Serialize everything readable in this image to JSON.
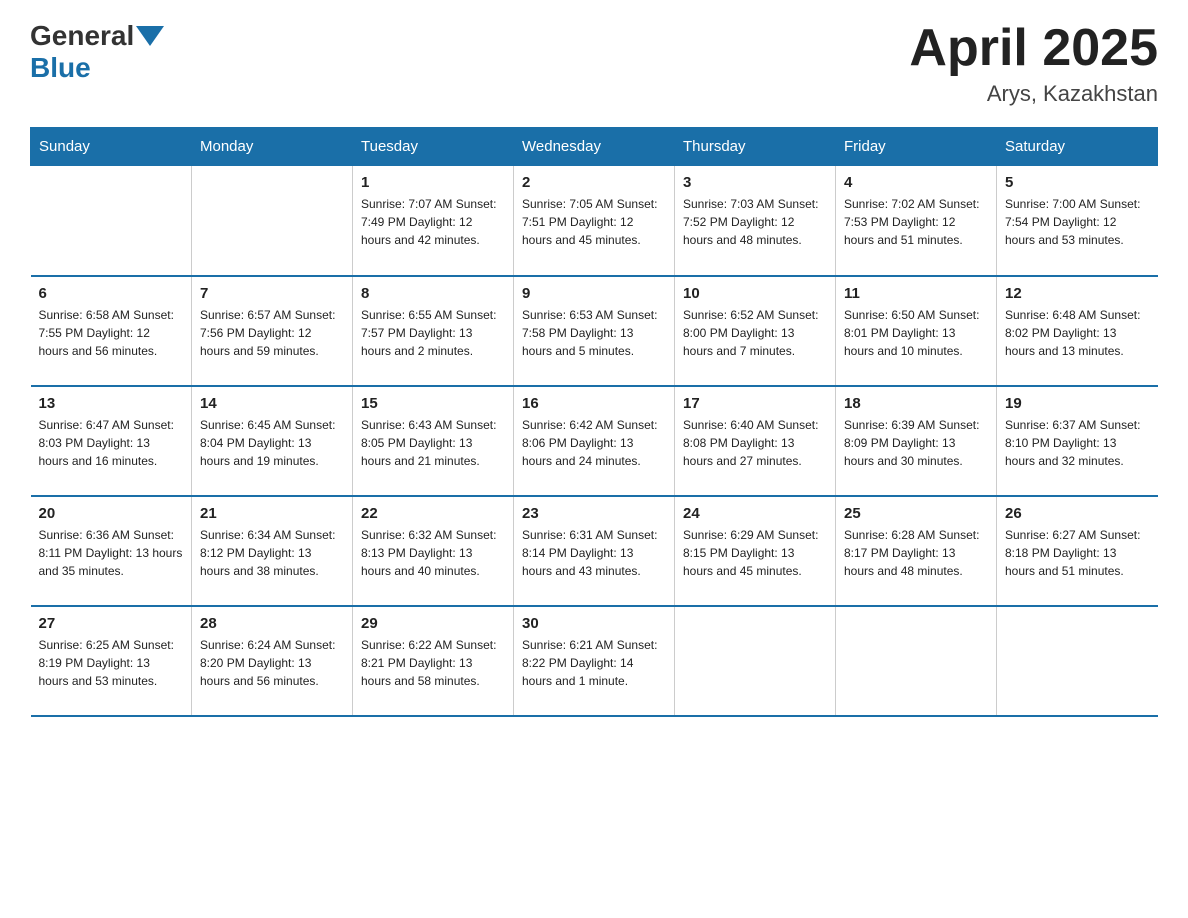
{
  "header": {
    "logo_general": "General",
    "logo_blue": "Blue",
    "month": "April 2025",
    "location": "Arys, Kazakhstan"
  },
  "weekdays": [
    "Sunday",
    "Monday",
    "Tuesday",
    "Wednesday",
    "Thursday",
    "Friday",
    "Saturday"
  ],
  "weeks": [
    [
      {
        "day": "",
        "info": ""
      },
      {
        "day": "",
        "info": ""
      },
      {
        "day": "1",
        "info": "Sunrise: 7:07 AM\nSunset: 7:49 PM\nDaylight: 12 hours\nand 42 minutes."
      },
      {
        "day": "2",
        "info": "Sunrise: 7:05 AM\nSunset: 7:51 PM\nDaylight: 12 hours\nand 45 minutes."
      },
      {
        "day": "3",
        "info": "Sunrise: 7:03 AM\nSunset: 7:52 PM\nDaylight: 12 hours\nand 48 minutes."
      },
      {
        "day": "4",
        "info": "Sunrise: 7:02 AM\nSunset: 7:53 PM\nDaylight: 12 hours\nand 51 minutes."
      },
      {
        "day": "5",
        "info": "Sunrise: 7:00 AM\nSunset: 7:54 PM\nDaylight: 12 hours\nand 53 minutes."
      }
    ],
    [
      {
        "day": "6",
        "info": "Sunrise: 6:58 AM\nSunset: 7:55 PM\nDaylight: 12 hours\nand 56 minutes."
      },
      {
        "day": "7",
        "info": "Sunrise: 6:57 AM\nSunset: 7:56 PM\nDaylight: 12 hours\nand 59 minutes."
      },
      {
        "day": "8",
        "info": "Sunrise: 6:55 AM\nSunset: 7:57 PM\nDaylight: 13 hours\nand 2 minutes."
      },
      {
        "day": "9",
        "info": "Sunrise: 6:53 AM\nSunset: 7:58 PM\nDaylight: 13 hours\nand 5 minutes."
      },
      {
        "day": "10",
        "info": "Sunrise: 6:52 AM\nSunset: 8:00 PM\nDaylight: 13 hours\nand 7 minutes."
      },
      {
        "day": "11",
        "info": "Sunrise: 6:50 AM\nSunset: 8:01 PM\nDaylight: 13 hours\nand 10 minutes."
      },
      {
        "day": "12",
        "info": "Sunrise: 6:48 AM\nSunset: 8:02 PM\nDaylight: 13 hours\nand 13 minutes."
      }
    ],
    [
      {
        "day": "13",
        "info": "Sunrise: 6:47 AM\nSunset: 8:03 PM\nDaylight: 13 hours\nand 16 minutes."
      },
      {
        "day": "14",
        "info": "Sunrise: 6:45 AM\nSunset: 8:04 PM\nDaylight: 13 hours\nand 19 minutes."
      },
      {
        "day": "15",
        "info": "Sunrise: 6:43 AM\nSunset: 8:05 PM\nDaylight: 13 hours\nand 21 minutes."
      },
      {
        "day": "16",
        "info": "Sunrise: 6:42 AM\nSunset: 8:06 PM\nDaylight: 13 hours\nand 24 minutes."
      },
      {
        "day": "17",
        "info": "Sunrise: 6:40 AM\nSunset: 8:08 PM\nDaylight: 13 hours\nand 27 minutes."
      },
      {
        "day": "18",
        "info": "Sunrise: 6:39 AM\nSunset: 8:09 PM\nDaylight: 13 hours\nand 30 minutes."
      },
      {
        "day": "19",
        "info": "Sunrise: 6:37 AM\nSunset: 8:10 PM\nDaylight: 13 hours\nand 32 minutes."
      }
    ],
    [
      {
        "day": "20",
        "info": "Sunrise: 6:36 AM\nSunset: 8:11 PM\nDaylight: 13 hours\nand 35 minutes."
      },
      {
        "day": "21",
        "info": "Sunrise: 6:34 AM\nSunset: 8:12 PM\nDaylight: 13 hours\nand 38 minutes."
      },
      {
        "day": "22",
        "info": "Sunrise: 6:32 AM\nSunset: 8:13 PM\nDaylight: 13 hours\nand 40 minutes."
      },
      {
        "day": "23",
        "info": "Sunrise: 6:31 AM\nSunset: 8:14 PM\nDaylight: 13 hours\nand 43 minutes."
      },
      {
        "day": "24",
        "info": "Sunrise: 6:29 AM\nSunset: 8:15 PM\nDaylight: 13 hours\nand 45 minutes."
      },
      {
        "day": "25",
        "info": "Sunrise: 6:28 AM\nSunset: 8:17 PM\nDaylight: 13 hours\nand 48 minutes."
      },
      {
        "day": "26",
        "info": "Sunrise: 6:27 AM\nSunset: 8:18 PM\nDaylight: 13 hours\nand 51 minutes."
      }
    ],
    [
      {
        "day": "27",
        "info": "Sunrise: 6:25 AM\nSunset: 8:19 PM\nDaylight: 13 hours\nand 53 minutes."
      },
      {
        "day": "28",
        "info": "Sunrise: 6:24 AM\nSunset: 8:20 PM\nDaylight: 13 hours\nand 56 minutes."
      },
      {
        "day": "29",
        "info": "Sunrise: 6:22 AM\nSunset: 8:21 PM\nDaylight: 13 hours\nand 58 minutes."
      },
      {
        "day": "30",
        "info": "Sunrise: 6:21 AM\nSunset: 8:22 PM\nDaylight: 14 hours\nand 1 minute."
      },
      {
        "day": "",
        "info": ""
      },
      {
        "day": "",
        "info": ""
      },
      {
        "day": "",
        "info": ""
      }
    ]
  ]
}
